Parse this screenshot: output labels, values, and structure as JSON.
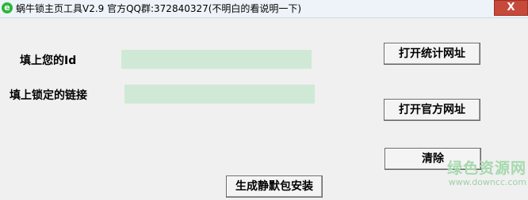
{
  "window": {
    "title": "蜗牛锁主页工具V2.9 官方QQ群:372840327(不明白的看说明一下)",
    "app_icon": "e",
    "close_label": "X"
  },
  "form": {
    "id_label": "填上您的Id",
    "id_value": "",
    "link_label": "填上锁定的链接",
    "link_value": ""
  },
  "buttons": {
    "open_stats": "打开统计网址",
    "open_official": "打开官方网址",
    "clear": "清除",
    "generate": "生成静默包安装"
  },
  "watermark": {
    "text": "绿色资源网",
    "url": "www.downcc.com"
  },
  "colors": {
    "input_bg": "#cfe9d6",
    "close_bg": "#c7493c",
    "watermark": "#a6d9ae"
  }
}
